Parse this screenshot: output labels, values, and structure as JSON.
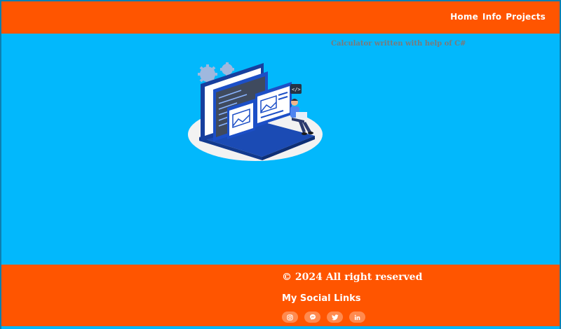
{
  "nav": {
    "items": [
      {
        "label": "Home"
      },
      {
        "label": "Info"
      },
      {
        "label": "Projects"
      }
    ]
  },
  "main": {
    "caption": "Calculator written with help of C#",
    "illustration_icon": "developer-laptop-illustration"
  },
  "footer": {
    "copyright": "© 2024 All right reserved",
    "social_title": "My Social Links",
    "socials": [
      {
        "icon": "instagram-icon"
      },
      {
        "icon": "messenger-icon"
      },
      {
        "icon": "twitter-icon"
      },
      {
        "icon": "linkedin-icon"
      }
    ]
  },
  "colors": {
    "background": "#02b8fc",
    "accent": "#ff5500",
    "button": "#ff8a4f",
    "text_light": "#ffffff",
    "caption": "#7a7a7a"
  }
}
